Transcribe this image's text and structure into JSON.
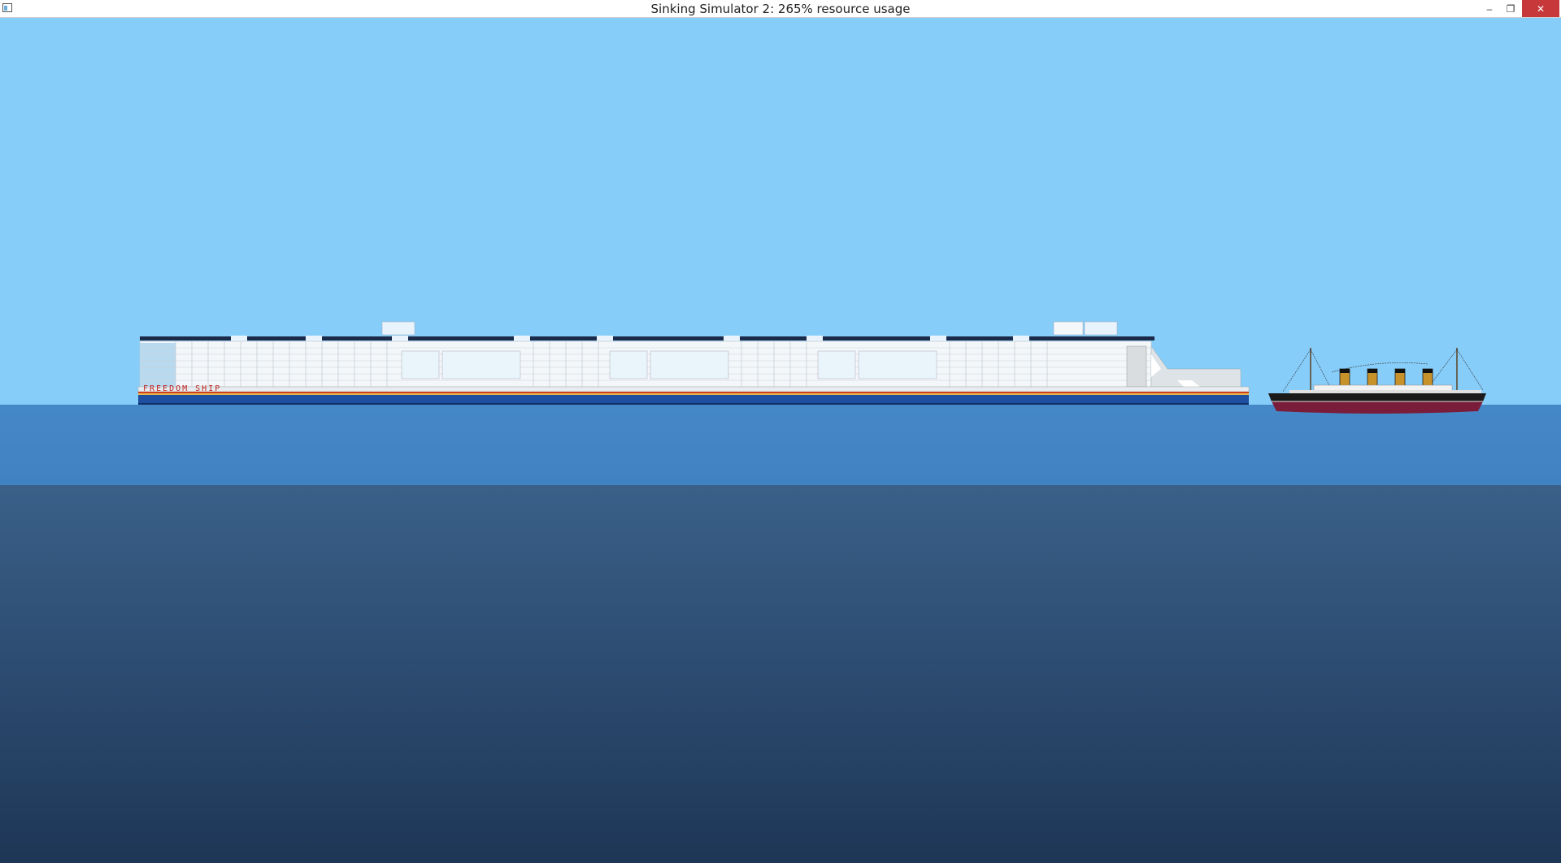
{
  "window": {
    "title": "Sinking Simulator 2: 265% resource usage",
    "controls": {
      "minimize": "–",
      "maximize": "❐",
      "close": "✕"
    },
    "icon": "app-icon"
  },
  "scene": {
    "sky_color": "#87cdf9",
    "sea_surface_color": "#4386c6",
    "deep_sea_color": "#2b4a74"
  },
  "ships": {
    "large_ship": {
      "hull_label": "FREEDOM SHIP",
      "hull_color": "#1f4fa0",
      "stripe_color": "#d04020"
    },
    "small_ship": {
      "hull_color": "#7a1d3a",
      "funnel_color": "#c8922a"
    }
  }
}
